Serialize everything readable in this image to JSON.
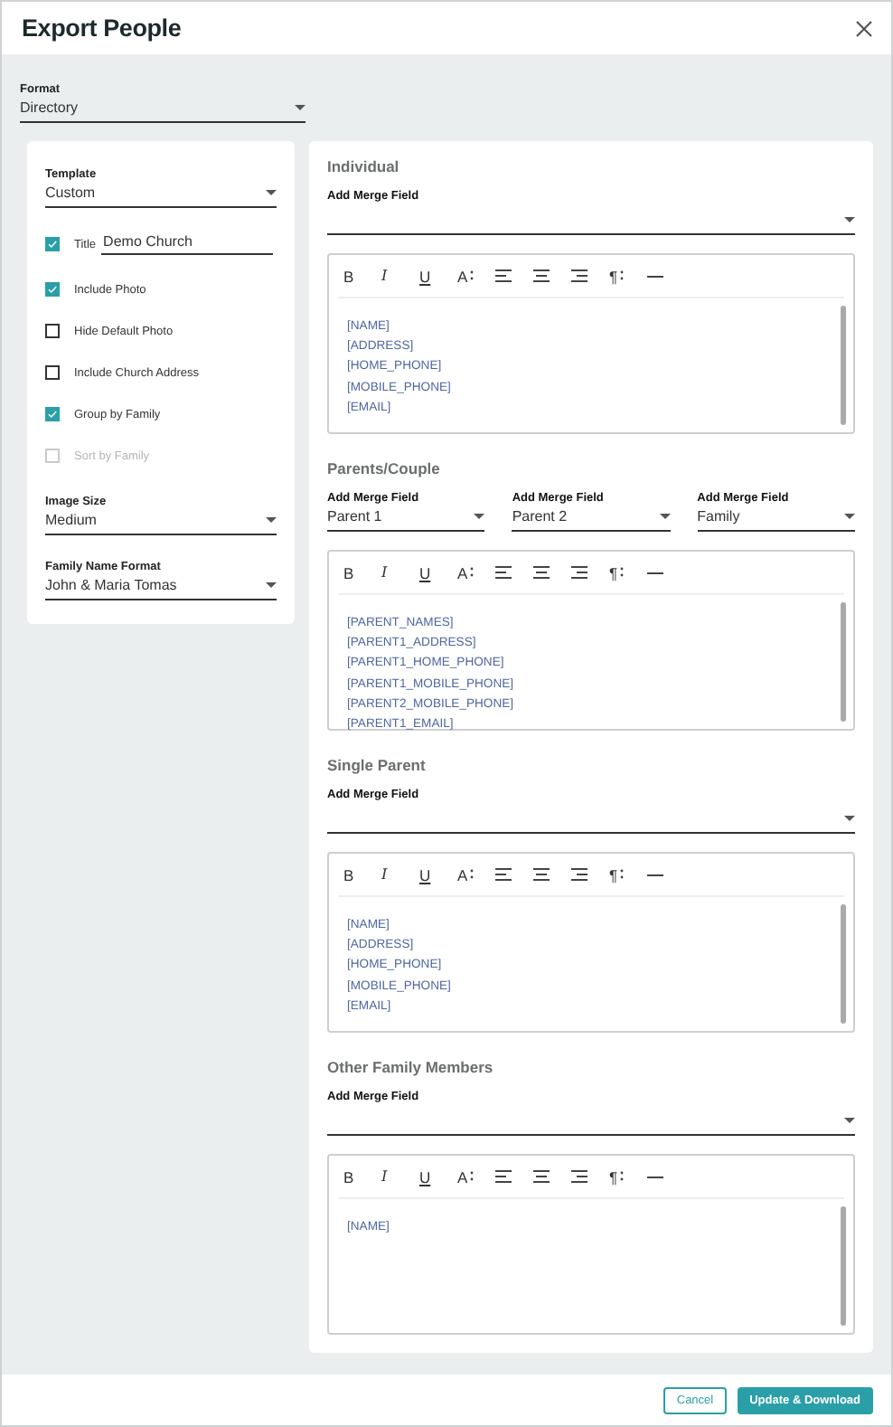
{
  "window": {
    "title": "Export People"
  },
  "format": {
    "label": "Format",
    "value": "Directory"
  },
  "settings": {
    "template": {
      "label": "Template",
      "value": "Custom"
    },
    "options": [
      {
        "label": "Title",
        "checked": true,
        "disabled": false,
        "value": "Demo Church"
      },
      {
        "label": "Include Photo",
        "checked": true,
        "disabled": false
      },
      {
        "label": "Hide Default Photo",
        "checked": false,
        "disabled": false
      },
      {
        "label": "Include Church Address",
        "checked": false,
        "disabled": false
      },
      {
        "label": "Group by Family",
        "checked": true,
        "disabled": false
      },
      {
        "label": "Sort by Family",
        "checked": false,
        "disabled": true
      }
    ],
    "selects": [
      {
        "label": "Image Size",
        "value": "Medium"
      },
      {
        "label": "Family Name Format",
        "value": "John & Maria Tomas"
      }
    ]
  },
  "sections": [
    {
      "title": "Individual",
      "fields": [
        {
          "label": "Add Merge Field"
        }
      ],
      "toolbar": [
        {
          "kind": "bold",
          "label": "B"
        },
        {
          "kind": "italic",
          "label": "I"
        },
        {
          "kind": "underline",
          "label": "U"
        },
        {
          "kind": "font-size",
          "label": "A"
        },
        {
          "kind": "align-left"
        },
        {
          "kind": "align-center"
        },
        {
          "kind": "align-right"
        },
        {
          "kind": "paragraph",
          "label": "¶"
        },
        {
          "kind": "horizontal-rule"
        }
      ],
      "lines": [
        "[NAME]",
        "[ADDRESS]",
        "[HOME_PHONE]",
        "[MOBILE_PHONE]",
        "[EMAIL]"
      ]
    },
    {
      "title": "Parents/Couple",
      "fields": [
        {
          "label": "Add Merge Field",
          "value": "Parent 1"
        },
        {
          "label": "Add Merge Field",
          "value": "Parent 2"
        },
        {
          "label": "Add Merge Field",
          "value": "Family"
        }
      ],
      "toolbar": [
        {
          "kind": "bold",
          "label": "B"
        },
        {
          "kind": "italic",
          "label": "I"
        },
        {
          "kind": "underline",
          "label": "U"
        },
        {
          "kind": "font-size",
          "label": "A"
        },
        {
          "kind": "align-left"
        },
        {
          "kind": "align-center"
        },
        {
          "kind": "align-right"
        },
        {
          "kind": "paragraph",
          "label": "¶"
        },
        {
          "kind": "horizontal-rule"
        }
      ],
      "lines": [
        "[PARENT_NAMES]",
        "[PARENT1_ADDRESS]",
        "[PARENT1_HOME_PHONE]",
        "[PARENT1_MOBILE_PHONE]",
        "[PARENT2_MOBILE_PHONE]",
        "[PARENT1_EMAIL]"
      ]
    },
    {
      "title": "Single Parent",
      "fields": [
        {
          "label": "Add Merge Field"
        }
      ],
      "toolbar": [
        {
          "kind": "bold",
          "label": "B"
        },
        {
          "kind": "italic",
          "label": "I"
        },
        {
          "kind": "underline",
          "label": "U"
        },
        {
          "kind": "font-size",
          "label": "A"
        },
        {
          "kind": "align-left"
        },
        {
          "kind": "align-center"
        },
        {
          "kind": "align-right"
        },
        {
          "kind": "paragraph",
          "label": "¶"
        },
        {
          "kind": "horizontal-rule"
        }
      ],
      "lines": [
        "[NAME]",
        "[ADDRESS]",
        "[HOME_PHONE]",
        "[MOBILE_PHONE]",
        "[EMAIL]"
      ]
    },
    {
      "title": "Other Family Members",
      "fields": [
        {
          "label": "Add Merge Field"
        }
      ],
      "toolbar": [
        {
          "kind": "bold",
          "label": "B"
        },
        {
          "kind": "italic",
          "label": "I"
        },
        {
          "kind": "underline",
          "label": "U"
        },
        {
          "kind": "font-size",
          "label": "A"
        },
        {
          "kind": "align-left"
        },
        {
          "kind": "align-center"
        },
        {
          "kind": "align-right"
        },
        {
          "kind": "paragraph",
          "label": "¶"
        },
        {
          "kind": "horizontal-rule"
        }
      ],
      "lines": [
        "[NAME]"
      ]
    }
  ],
  "buttons": [
    {
      "kind": "secondary",
      "label": "Cancel"
    },
    {
      "kind": "primary",
      "label": "Update & Download"
    }
  ]
}
